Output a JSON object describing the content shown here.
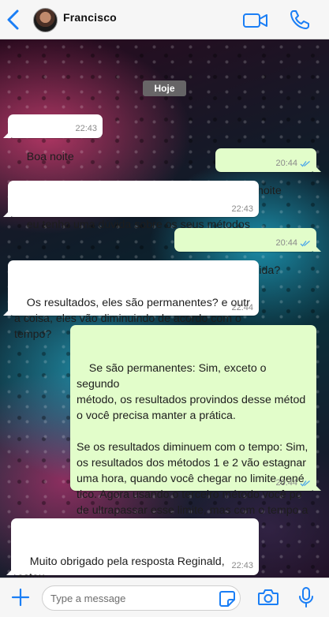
{
  "header": {
    "contact_name": "Francisco"
  },
  "chat": {
    "date_label": "Hoje",
    "messages": [
      {
        "direction": "in",
        "text": "Boa noite",
        "time": "22:43"
      },
      {
        "direction": "out",
        "text": "Boa noite",
        "time": "20:44",
        "read": true
      },
      {
        "direction": "in",
        "text": "eu tenho uma dúvida sobre os seus métodos",
        "time": "22:43"
      },
      {
        "direction": "out",
        "text": "Qual sua dúvida?",
        "time": "20:44",
        "read": true
      },
      {
        "direction": "in",
        "text": "Os resultados, eles são permanentes? e outr\na coisa, eles vão diminuindo de acordo com o\ntempo?",
        "time": "22:44"
      },
      {
        "direction": "out",
        "text": "Se são permanentes: Sim, exceto o segundo\nmétodo, os resultados provindos desse métod\no você precisa manter a prática.\n\nSe os resultados diminuem com o tempo: Sim,\nos resultados dos métodos 1 e 2 vão estagnar\numa hora, quando você chegar no limite gené\ntico. Agora usando o terceiro método você po\nde ultrapassar esse limite, mas com o tempo a\nvelocidade de crescimento diminui.",
        "time": "20:44",
        "read": true
      },
      {
        "direction": "in",
        "text": "Muito obrigado pela resposta Reginald, estou\npraticando os métodos já faz 1 mês, cresci 4c\nm até o momento.",
        "time": "22:43"
      }
    ]
  },
  "footer": {
    "input_placeholder": "Type a message",
    "input_value": ""
  },
  "icons": {
    "back": "chevron-left-icon",
    "video": "video-camera-icon",
    "call": "phone-icon",
    "plus": "plus-icon",
    "sticker": "sticker-icon",
    "camera": "camera-icon",
    "mic": "microphone-icon"
  },
  "colors": {
    "accent": "#1a7ef5",
    "incoming_bubble": "#ffffff",
    "outgoing_bubble": "#e2fdca",
    "read_ticks": "#4fa8e8"
  }
}
